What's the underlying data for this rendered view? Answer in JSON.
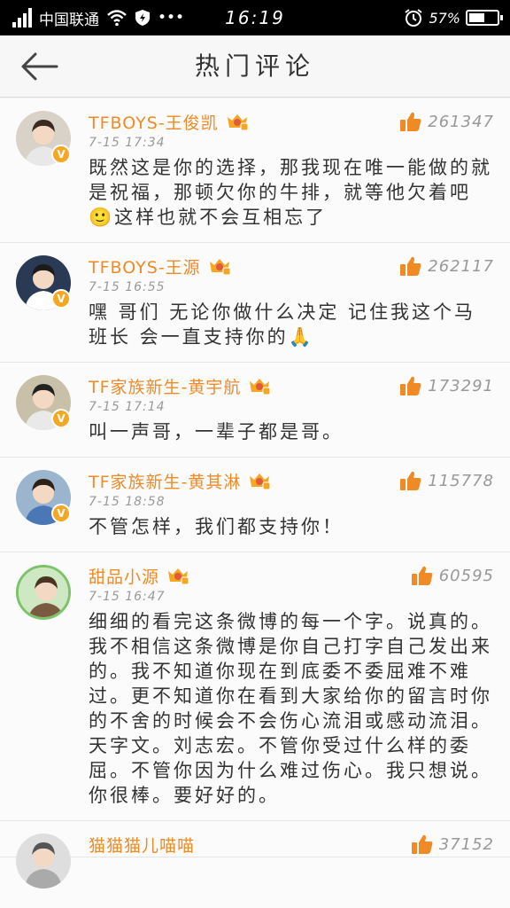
{
  "status_bar": {
    "carrier": "中国联通",
    "dots": "•••",
    "time": "16:19",
    "battery": "57%",
    "battery_level": 0.57
  },
  "header": {
    "title": "热门评论"
  },
  "comments": [
    {
      "name": "TFBOYS-王俊凯",
      "time": "7-15 17:34",
      "likes": "261347",
      "text": "既然这是你的选择，那我现在唯一能做的就是祝福，那顿欠你的牛排，就等他欠着吧🙂这样也就不会互相忘了",
      "verified": true
    },
    {
      "name": "TFBOYS-王源",
      "time": "7-15 16:55",
      "likes": "262117",
      "text": "嘿 哥们 无论你做什么决定 记住我这个马班长 会一直支持你的🙏",
      "verified": true
    },
    {
      "name": "TF家族新生-黄宇航",
      "time": "7-15 17:14",
      "likes": "173291",
      "text": "叫一声哥，一辈子都是哥。",
      "verified": true
    },
    {
      "name": "TF家族新生-黄其淋",
      "time": "7-15 18:58",
      "likes": "115778",
      "text": "不管怎样，我们都支持你！",
      "verified": true
    },
    {
      "name": "甜品小源",
      "time": "7-15 16:47",
      "likes": "60595",
      "text": "细细的看完这条微博的每一个字。说真的。我不相信这条微博是你自己打字自己发出来的。我不知道你现在到底委不委屈难不难过。更不知道你在看到大家给你的留言时你的不舍的时候会不会伤心流泪或感动流泪。天字文。刘志宏。不管你受过什么样的委屈。不管你因为什么难过伤心。我只想说。你很棒。要好好的。",
      "verified": false
    },
    {
      "name": "猫猫猫儿喵喵",
      "time": "",
      "likes": "37152",
      "text": "",
      "verified": false
    }
  ]
}
